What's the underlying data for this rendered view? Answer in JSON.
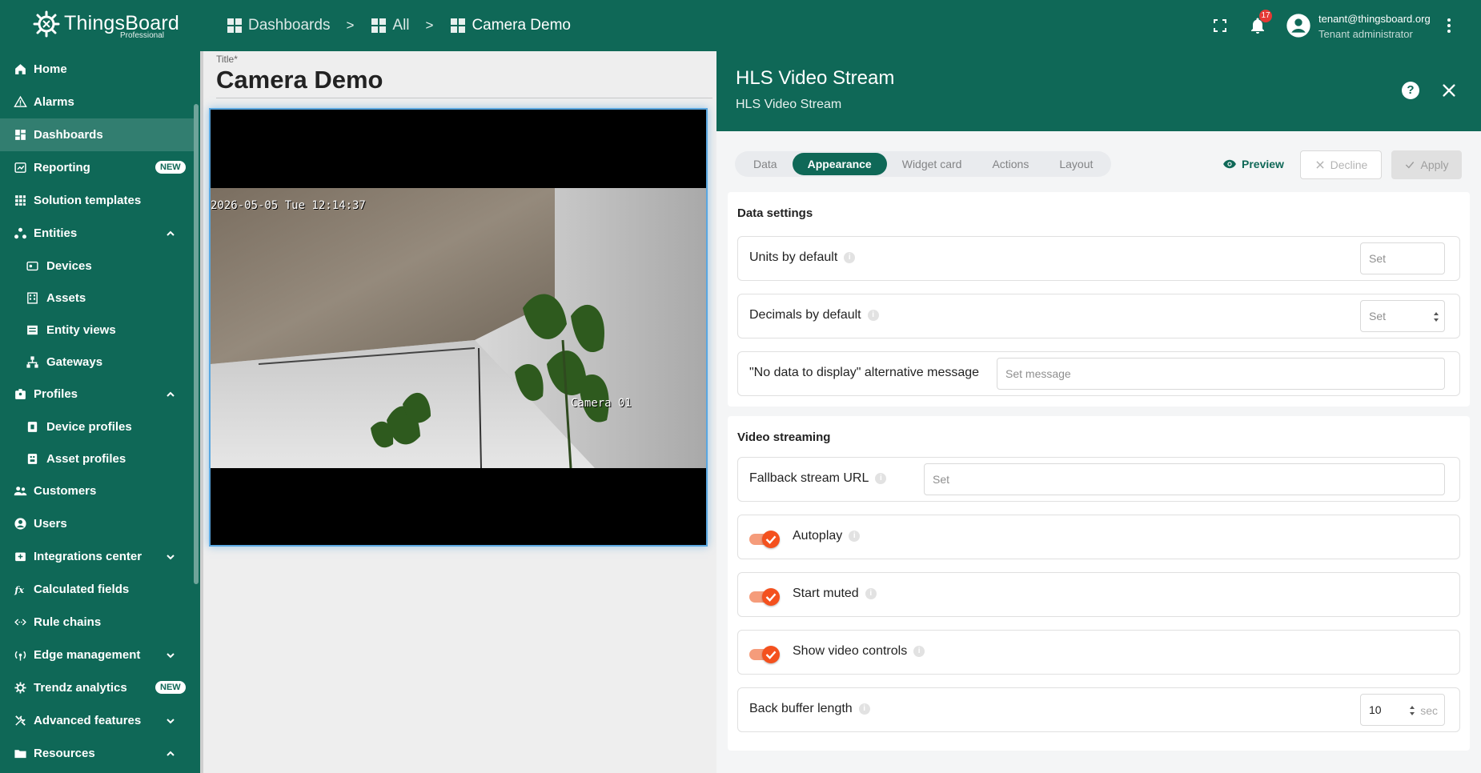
{
  "app": {
    "logo_name": "ThingsBoard",
    "logo_edition": "Professional"
  },
  "breadcrumb": [
    {
      "label": "Dashboards",
      "icon": "dashboard-icon"
    },
    {
      "label": "All",
      "icon": "dashboard-icon"
    },
    {
      "label": "Camera Demo",
      "icon": "dashboard-icon"
    }
  ],
  "breadcrumb_separator": ">",
  "topbar": {
    "notification_count": "17",
    "user_email": "tenant@thingsboard.org",
    "user_role": "Tenant administrator"
  },
  "sidebar": {
    "items": [
      {
        "label": "Home",
        "icon": "home-icon"
      },
      {
        "label": "Alarms",
        "icon": "alarm-icon"
      },
      {
        "label": "Dashboards",
        "icon": "dashboard-icon",
        "active": true
      },
      {
        "label": "Reporting",
        "icon": "report-icon",
        "badge": "NEW"
      },
      {
        "label": "Solution templates",
        "icon": "apps-icon"
      },
      {
        "label": "Entities",
        "icon": "entities-icon",
        "expanded": true
      },
      {
        "label": "Devices",
        "icon": "device-icon",
        "sub": true
      },
      {
        "label": "Assets",
        "icon": "asset-icon",
        "sub": true
      },
      {
        "label": "Entity views",
        "icon": "entity-view-icon",
        "sub": true
      },
      {
        "label": "Gateways",
        "icon": "gateway-icon",
        "sub": true
      },
      {
        "label": "Profiles",
        "icon": "profiles-icon",
        "expanded": true
      },
      {
        "label": "Device profiles",
        "icon": "device-profile-icon",
        "sub": true
      },
      {
        "label": "Asset profiles",
        "icon": "asset-profile-icon",
        "sub": true
      },
      {
        "label": "Customers",
        "icon": "customers-icon"
      },
      {
        "label": "Users",
        "icon": "user-icon"
      },
      {
        "label": "Integrations center",
        "icon": "integrations-icon",
        "collapsed": true
      },
      {
        "label": "Calculated fields",
        "icon": "function-icon"
      },
      {
        "label": "Rule chains",
        "icon": "rule-chain-icon"
      },
      {
        "label": "Edge management",
        "icon": "edge-icon",
        "collapsed": true
      },
      {
        "label": "Trendz analytics",
        "icon": "trendz-icon",
        "badge": "NEW"
      },
      {
        "label": "Advanced features",
        "icon": "tools-icon",
        "collapsed": true
      },
      {
        "label": "Resources",
        "icon": "folder-icon",
        "expanded": true
      }
    ]
  },
  "dashboard": {
    "title_caption": "Title*",
    "title": "Camera Demo",
    "video": {
      "timestamp_overlay": "2026-05-05 Tue 12:14:37",
      "camera_overlay": "Camera 01"
    }
  },
  "panel": {
    "title": "HLS Video Stream",
    "subtitle": "HLS Video Stream",
    "tabs": [
      "Data",
      "Appearance",
      "Widget card",
      "Actions",
      "Layout"
    ],
    "active_tab": "Appearance",
    "preview_label": "Preview",
    "decline_label": "Decline",
    "apply_label": "Apply",
    "data_settings": {
      "title": "Data settings",
      "units_label": "Units by default",
      "units_placeholder": "Set",
      "decimals_label": "Decimals by default",
      "decimals_placeholder": "Set",
      "no_data_label": "\"No data to display\" alternative message",
      "no_data_placeholder": "Set message"
    },
    "video_streaming": {
      "title": "Video streaming",
      "fallback_label": "Fallback stream URL",
      "fallback_placeholder": "Set",
      "autoplay_label": "Autoplay",
      "autoplay": true,
      "muted_label": "Start muted",
      "muted": true,
      "controls_label": "Show video controls",
      "controls": true,
      "buffer_label": "Back buffer length",
      "buffer_value": "10",
      "buffer_unit": "sec"
    }
  },
  "colors": {
    "primary": "#0f6857",
    "toggle_on": "#f4511e"
  }
}
